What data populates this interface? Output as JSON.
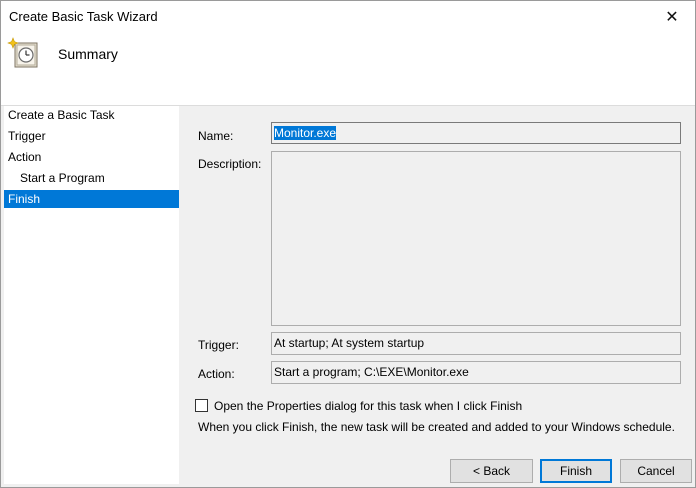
{
  "window": {
    "title": "Create Basic Task Wizard"
  },
  "header": {
    "title": "Summary",
    "icon": "task-clock-icon"
  },
  "sidebar": {
    "items": [
      {
        "label": "Create a Basic Task",
        "selected": false
      },
      {
        "label": "Trigger",
        "selected": false
      },
      {
        "label": "Action",
        "selected": false
      },
      {
        "label": "Start a Program",
        "selected": false
      },
      {
        "label": "Finish",
        "selected": true
      }
    ]
  },
  "form": {
    "name_label": "Name:",
    "name_value": "Monitor.exe",
    "description_label": "Description:",
    "description_value": "",
    "trigger_label": "Trigger:",
    "trigger_value": "At startup; At system startup",
    "action_label": "Action:",
    "action_value": "Start a program; C:\\EXE\\Monitor.exe",
    "checkbox_label": "Open the Properties dialog for this task when I click Finish",
    "checkbox_checked": false,
    "info_text": "When you click Finish, the new task will be created and added to your Windows schedule."
  },
  "buttons": {
    "back": "< Back",
    "finish": "Finish",
    "cancel": "Cancel"
  },
  "colors": {
    "selection": "#0078d7",
    "dialog_bg": "#f0f0f0"
  }
}
